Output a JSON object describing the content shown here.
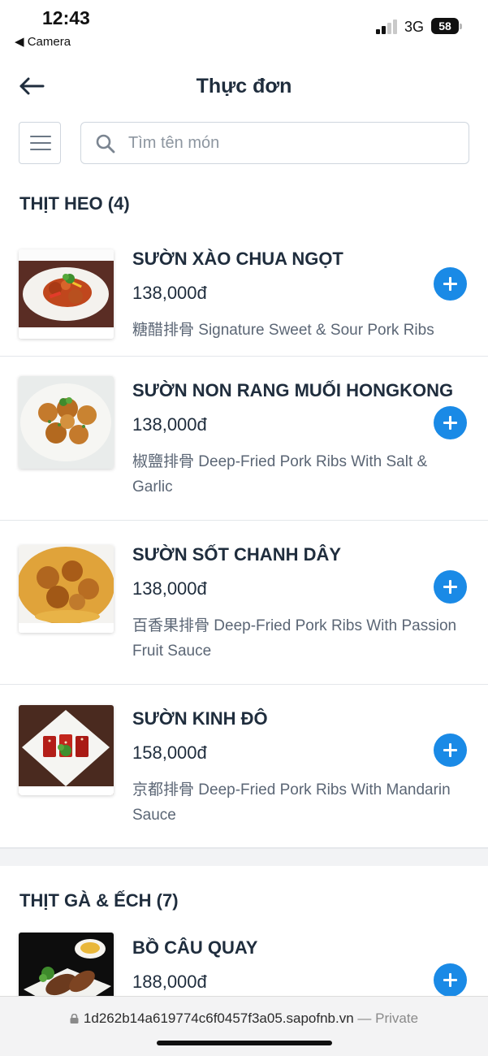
{
  "status_bar": {
    "time": "12:43",
    "back_app": "◀ Camera",
    "network": "3G",
    "battery": "58"
  },
  "header": {
    "title": "Thực đơn"
  },
  "search": {
    "placeholder": "Tìm tên món"
  },
  "categories": [
    {
      "title": "THỊT HEO (4)",
      "items": [
        {
          "name": "SƯỜN XÀO CHUA NGỌT",
          "price": "138,000đ",
          "description": "糖醋排骨 Signature Sweet & Sour Pork Ribs"
        },
        {
          "name": "SƯỜN NON RANG MUỐI HONGKONG",
          "price": "138,000đ",
          "description": "椒鹽排骨 Deep-Fried Pork Ribs With Salt & Garlic"
        },
        {
          "name": "SƯỜN SỐT CHANH DÂY",
          "price": "138,000đ",
          "description": "百香果排骨 Deep-Fried Pork Ribs With Passion Fruit Sauce"
        },
        {
          "name": "SƯỜN KINH ĐÔ",
          "price": "158,000đ",
          "description": "京都排骨 Deep-Fried Pork Ribs With Mandarin Sauce"
        }
      ]
    },
    {
      "title": "THỊT GÀ & ẾCH (7)",
      "items": [
        {
          "name": "BỒ CÂU QUAY",
          "price": "188,000đ",
          "description": ""
        }
      ]
    }
  ],
  "browser": {
    "url": "1d262b14a619774c6f0457f3a05.sapofnb.vn",
    "private_label": "— Private"
  },
  "colors": {
    "accent": "#1a8ae6",
    "text": "#1f2d3d",
    "muted": "#5b6675"
  }
}
